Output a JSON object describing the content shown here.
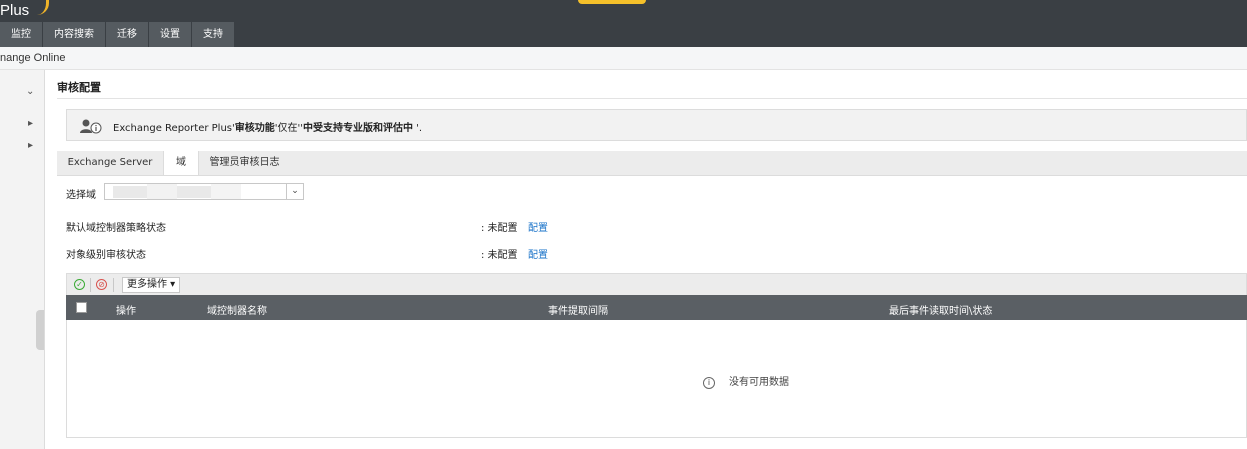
{
  "header": {
    "brand": "Plus",
    "nav_tabs": [
      "监控",
      "内容搜索",
      "迁移",
      "设置",
      "支持"
    ]
  },
  "breadcrumb": "nange Online",
  "page": {
    "title": "审核配置",
    "banner": {
      "prefix": "Exchange Reporter Plus'",
      "bold1": "审核功能",
      "middle": "'仅在''",
      "bold2": "中受支持专业版和评估中",
      "suffix": " '."
    },
    "tabs": [
      "Exchange Server",
      "域",
      "管理员审核日志"
    ],
    "active_tab": "域",
    "select_domain_label": "选择域",
    "rows": [
      {
        "label": "默认域控制器策略状态",
        "status": ": 未配置",
        "action": "配置"
      },
      {
        "label": "对象级别审核状态",
        "status": ": 未配置",
        "action": "配置"
      }
    ],
    "toolbar": {
      "enable_icon": "check-circle-icon",
      "disable_icon": "ban-circle-icon",
      "more_actions": "更多操作 ▾"
    },
    "table": {
      "columns": [
        "操作",
        "域控制器名称",
        "事件提取间隔",
        "最后事件读取时间\\状态"
      ],
      "empty_text": "没有可用数据"
    }
  },
  "colors": {
    "header_bg": "#3a3f44",
    "nav_tab_bg": "#555b60",
    "table_header_bg": "#5a5f64",
    "link": "#1a73c9",
    "brand_accent": "#f0b429",
    "enable_green": "#3aaa35",
    "disable_red": "#d9534f"
  }
}
